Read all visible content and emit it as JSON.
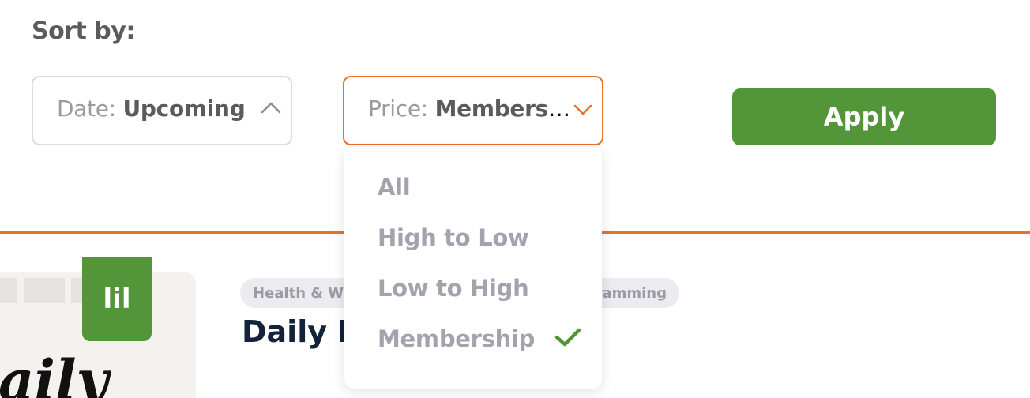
{
  "sort": {
    "label": "Sort by:",
    "date_select": {
      "key": "Date:",
      "value": "Upcoming",
      "icon": "chevron-up-icon"
    },
    "price_select": {
      "key": "Price:",
      "value": "Membersh…",
      "icon": "chevron-down-icon"
    },
    "apply_label": "Apply"
  },
  "price_options": [
    {
      "label": "All"
    },
    {
      "label": "High to Low"
    },
    {
      "label": "Low to High"
    },
    {
      "label": "Membership",
      "selected": true
    }
  ],
  "card": {
    "logo_text": "lil",
    "image_script": "aily",
    "tags": [
      "Health & Wel",
      "ramming"
    ],
    "title": "Daily H"
  },
  "colors": {
    "accent_orange": "#e8702a",
    "brand_green": "#53963a",
    "text_dark": "#13233a",
    "muted": "#a4a2ad"
  }
}
